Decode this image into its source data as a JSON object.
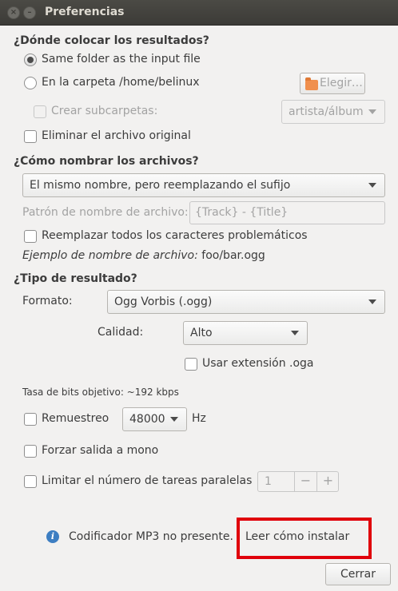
{
  "window": {
    "title": "Preferencias"
  },
  "where": {
    "heading": "¿Dónde colocar los resultados?",
    "radio_same_folder": "Same folder as the input file",
    "radio_custom_folder": "En la carpeta /home/belinux",
    "choose_button": "Elegir…",
    "create_subfolders": "Crear subcarpetas:",
    "subfolder_pattern": "artista/álbum",
    "delete_original": "Eliminar el archivo original"
  },
  "naming": {
    "heading": "¿Cómo nombrar los archivos?",
    "naming_mode": "El mismo nombre, pero reemplazando el sufijo",
    "pattern_label": "Patrón de nombre de archivo:",
    "pattern_value": "{Track} - {Title}",
    "replace_chars": "Reemplazar todos los caracteres problemáticos",
    "example_label": "Ejemplo de nombre de archivo:",
    "example_value": "foo/bar.ogg"
  },
  "result": {
    "heading": "¿Tipo de resultado?",
    "format_label": "Formato:",
    "format_value": "Ogg Vorbis (.ogg)",
    "quality_label": "Calidad:",
    "quality_value": "Alto",
    "oga_ext": "Usar extensión .oga",
    "bitrate": "Tasa de bits objetivo: ~192 kbps",
    "resample_label": "Remuestreo",
    "resample_value": "48000",
    "resample_unit": "Hz",
    "force_mono": "Forzar salida a mono",
    "limit_tasks": "Limitar el número de tareas paralelas",
    "tasks_value": "1",
    "minus": "−",
    "plus": "+"
  },
  "footer": {
    "info_icon_glyph": "i",
    "mp3_notice": "Codificador MP3 no presente.",
    "install_link": "Leer cómo instalar",
    "close_button": "Cerrar"
  },
  "colors": {
    "titlebar": "#3c3b37",
    "background": "#f2f1f0",
    "highlight": "#e0000b",
    "info_icon": "#3d7ec2"
  }
}
